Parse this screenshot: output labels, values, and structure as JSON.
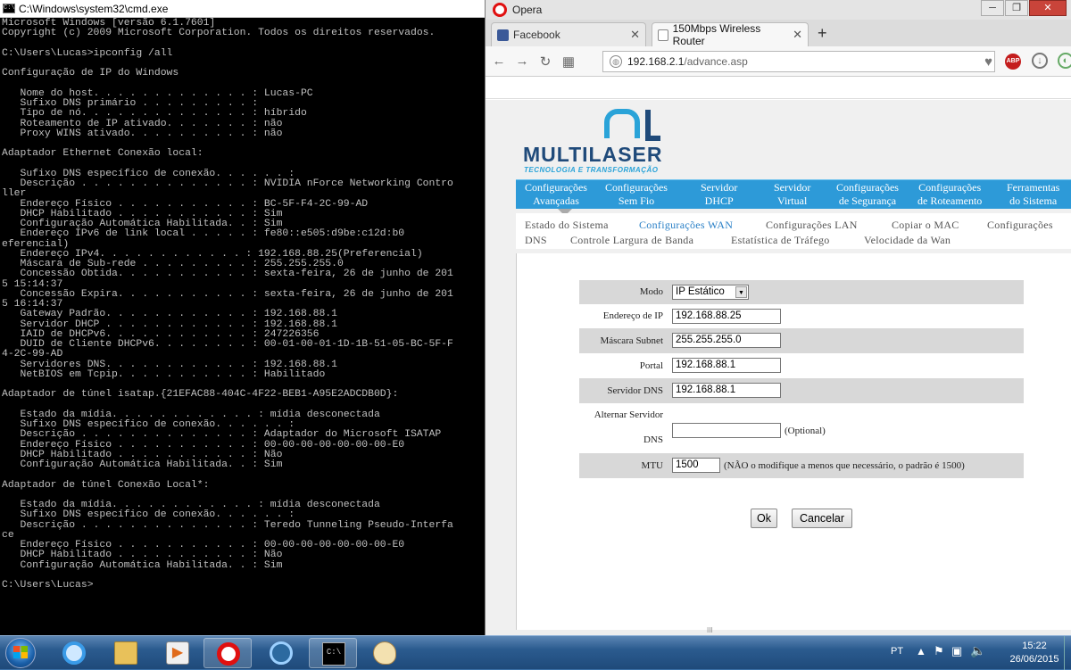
{
  "cmd": {
    "title": "C:\\Windows\\system32\\cmd.exe",
    "lines": [
      "Microsoft Windows [versão 6.1.7601]",
      "Copyright (c) 2009 Microsoft Corporation. Todos os direitos reservados.",
      "",
      "C:\\Users\\Lucas>ipconfig /all",
      "",
      "Configuração de IP do Windows",
      "",
      "   Nome do host. . . . . . . . . . . . . : Lucas-PC",
      "   Sufixo DNS primário . . . . . . . . . :",
      "   Tipo de nó. . . . . . . . . . . . . . : híbrido",
      "   Roteamento de IP ativado. . . . . . . : não",
      "   Proxy WINS ativado. . . . . . . . . . : não",
      "",
      "Adaptador Ethernet Conexão local:",
      "",
      "   Sufixo DNS específico de conexão. . . . . . :",
      "   Descrição . . . . . . . . . . . . . . : NVIDIA nForce Networking Contro",
      "ller",
      "   Endereço Físico . . . . . . . . . . . : BC-5F-F4-2C-99-AD",
      "   DHCP Habilitado . . . . . . . . . . . : Sim",
      "   Configuração Automática Habilitada. . : Sim",
      "   Endereço IPv6 de link local . . . . . : fe80::e505:d9be:c12d:b0",
      "eferencial)",
      "   Endereço IPv4. . . . . . . . . . . . : 192.168.88.25(Preferencial)",
      "   Máscara de Sub-rede . . . . . . . . . : 255.255.255.0",
      "   Concessão Obtida. . . . . . . . . . . : sexta-feira, 26 de junho de 201",
      "5 15:14:37",
      "   Concessão Expira. . . . . . . . . . . : sexta-feira, 26 de junho de 201",
      "5 16:14:37",
      "   Gateway Padrão. . . . . . . . . . . . : 192.168.88.1",
      "   Servidor DHCP . . . . . . . . . . . . : 192.168.88.1",
      "   IAID de DHCPv6. . . . . . . . . . . . : 247226356",
      "   DUID de Cliente DHCPv6. . . . . . . . : 00-01-00-01-1D-1B-51-05-BC-5F-F",
      "4-2C-99-AD",
      "   Servidores DNS. . . . . . . . . . . . : 192.168.88.1",
      "   NetBIOS em Tcpip. . . . . . . . . . . : Habilitado",
      "",
      "Adaptador de túnel isatap.{21EFAC88-404C-4F22-BEB1-A95E2ADCDB0D}:",
      "",
      "   Estado da mídia. . . . . . . . . . . . : mídia desconectada",
      "   Sufixo DNS específico de conexão. . . . . . :",
      "   Descrição . . . . . . . . . . . . . . : Adaptador do Microsoft ISATAP",
      "   Endereço Físico . . . . . . . . . . . : 00-00-00-00-00-00-00-E0",
      "   DHCP Habilitado . . . . . . . . . . . : Não",
      "   Configuração Automática Habilitada. . : Sim",
      "",
      "Adaptador de túnel Conexão Local*:",
      "",
      "   Estado da mídia. . . . . . . . . . . . : mídia desconectada",
      "   Sufixo DNS específico de conexão. . . . . . :",
      "   Descrição . . . . . . . . . . . . . . : Teredo Tunneling Pseudo-Interfa",
      "ce",
      "   Endereço Físico . . . . . . . . . . . : 00-00-00-00-00-00-00-E0",
      "   DHCP Habilitado . . . . . . . . . . . : Não",
      "   Configuração Automática Habilitada. . : Sim",
      "",
      "C:\\Users\\Lucas>"
    ]
  },
  "browser": {
    "app_title": "Opera",
    "tabs": [
      {
        "label": "Facebook",
        "close": "✕"
      },
      {
        "label": "150Mbps Wireless Router",
        "close": "✕"
      }
    ],
    "new_tab": "+",
    "url_host": "192.168.2.1",
    "url_path": "/advance.asp",
    "abp_label": "ABP",
    "colors": {
      "router_blue": "#2d9ad8",
      "logo_navy": "#1f4a7a",
      "selected_link": "#2a80c7"
    }
  },
  "router": {
    "logo_word": "MULTILASER",
    "logo_tagline": "TECNOLOGIA E TRANSFORMAÇÃO",
    "top_menu": [
      {
        "line1": "Configurações",
        "line2": "Avançadas"
      },
      {
        "line1": "Configurações",
        "line2": "Sem Fio"
      },
      {
        "line1": "Servidor",
        "line2": "DHCP"
      },
      {
        "line1": "Servidor",
        "line2": "Virtual"
      },
      {
        "line1": "Configurações",
        "line2": "de Segurança"
      },
      {
        "line1": "Configurações",
        "line2": "de Roteamento"
      },
      {
        "line1": "Ferramentas",
        "line2": "do Sistema"
      }
    ],
    "sub_menu": [
      "Estado do Sistema",
      "Configurações WAN",
      "Configurações LAN",
      "Copiar o MAC",
      "Configurações",
      "DNS",
      "Controle Largura de Banda",
      "Estatística de Tráfego",
      "Velocidade da Wan"
    ],
    "form": {
      "mode_label": "Modo",
      "mode_value": "IP Estático",
      "ip_label": "Endereço de IP",
      "ip_value": "192.168.88.25",
      "mask_label": "Máscara Subnet",
      "mask_value": "255.255.255.0",
      "gateway_label": "Portal",
      "gateway_value": "192.168.88.1",
      "dns_label": "Servidor DNS",
      "dns_value": "192.168.88.1",
      "alt_dns_label_1": "Alternar Servidor",
      "alt_dns_label_2": "DNS",
      "alt_dns_value": "",
      "alt_dns_note": "(Optional)",
      "mtu_label": "MTU",
      "mtu_value": "1500",
      "mtu_note": "(NÃO o modifique a menos que necessário, o padrão é 1500)",
      "ok_label": "Ok",
      "cancel_label": "Cancelar"
    },
    "scroll_grip": "III"
  },
  "taskbar": {
    "language": "PT",
    "time": "15:22",
    "date": "26/06/2015"
  }
}
